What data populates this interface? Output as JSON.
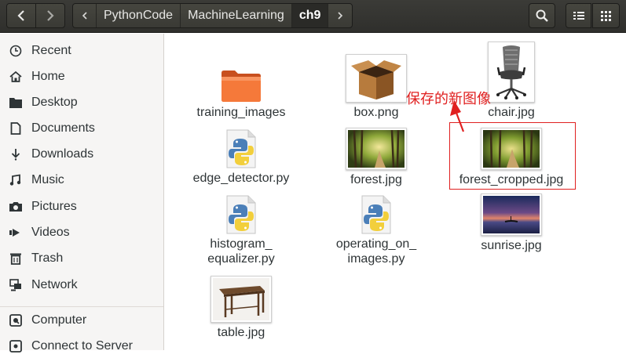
{
  "header": {
    "breadcrumbs": [
      "PythonCode",
      "MachineLearning",
      "ch9"
    ]
  },
  "sidebar": {
    "items": [
      {
        "label": "Recent",
        "icon": "clock-icon"
      },
      {
        "label": "Home",
        "icon": "home-icon"
      },
      {
        "label": "Desktop",
        "icon": "folder-icon"
      },
      {
        "label": "Documents",
        "icon": "document-icon"
      },
      {
        "label": "Downloads",
        "icon": "download-icon"
      },
      {
        "label": "Music",
        "icon": "music-icon"
      },
      {
        "label": "Pictures",
        "icon": "camera-icon"
      },
      {
        "label": "Videos",
        "icon": "video-icon"
      },
      {
        "label": "Trash",
        "icon": "trash-icon"
      },
      {
        "label": "Network",
        "icon": "network-icon"
      },
      {
        "label": "Computer",
        "icon": "computer-icon"
      },
      {
        "label": "Connect to Server",
        "icon": "server-icon"
      }
    ]
  },
  "files": [
    {
      "label": "training_images",
      "type": "folder"
    },
    {
      "label": "box.png",
      "type": "image"
    },
    {
      "label": "chair.jpg",
      "type": "image"
    },
    {
      "label": "edge_detector.py",
      "type": "python"
    },
    {
      "label": "forest.jpg",
      "type": "image"
    },
    {
      "label": "forest_cropped.jpg",
      "type": "image"
    },
    {
      "label_lines": [
        "histogram_",
        "equalizer.py"
      ],
      "type": "python"
    },
    {
      "label_lines": [
        "operating_on_",
        "images.py"
      ],
      "type": "python"
    },
    {
      "label": "sunrise.jpg",
      "type": "image"
    },
    {
      "label": "table.jpg",
      "type": "image"
    }
  ],
  "annotation": {
    "text": "保存的新图像",
    "color": "#e02020"
  },
  "colors": {
    "header_bg": "#3b3b37",
    "sidebar_bg": "#f6f5f4",
    "folder_orange": "#f5793a",
    "annotation_red": "#e02020"
  }
}
